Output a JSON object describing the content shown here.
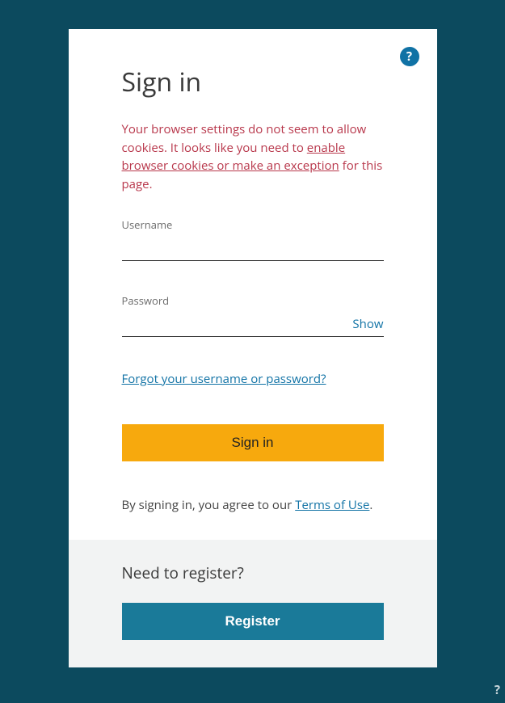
{
  "header": {
    "title": "Sign in",
    "help_icon": "?"
  },
  "warning": {
    "text_before": "Your browser settings do not seem to allow cookies. It looks like you need to ",
    "link_text": "enable browser cookies or make an exception",
    "text_after": " for this page."
  },
  "fields": {
    "username_label": "Username",
    "password_label": "Password",
    "show_label": "Show"
  },
  "links": {
    "forgot": "Forgot your username or password?"
  },
  "buttons": {
    "signin": "Sign in",
    "register": "Register"
  },
  "agree": {
    "text_before": "By signing in, you agree to our ",
    "link_text": "Terms of Use",
    "text_after": "."
  },
  "register": {
    "title": "Need to register?"
  },
  "corner_help": "?"
}
